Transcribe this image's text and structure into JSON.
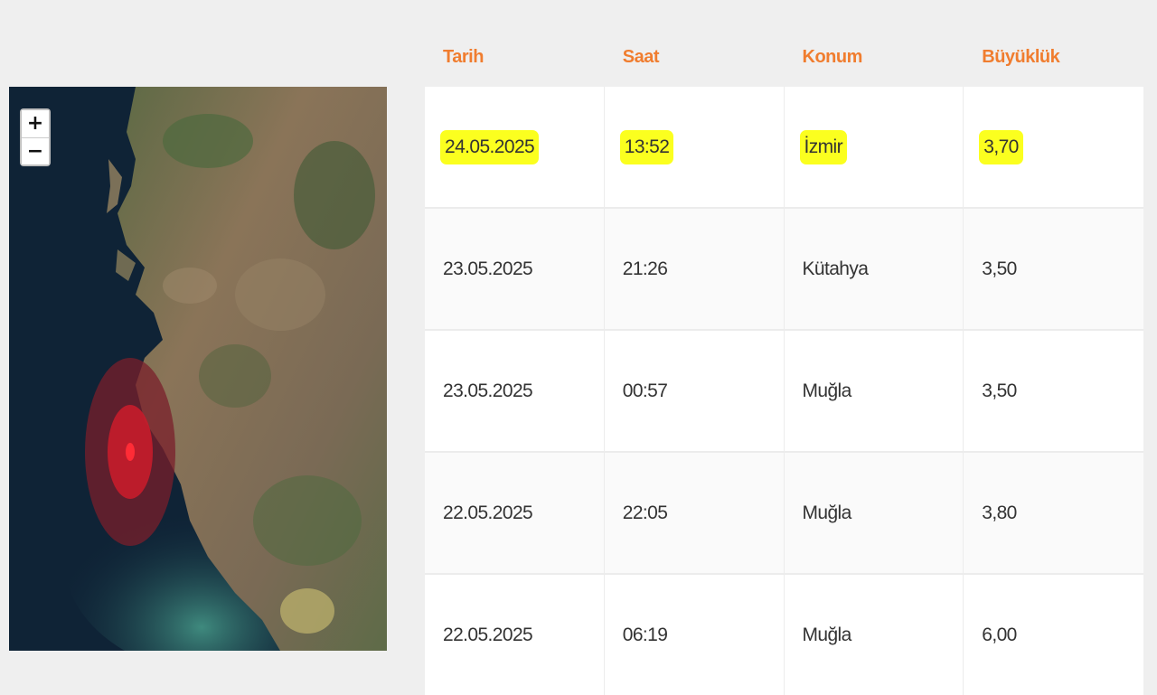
{
  "colors": {
    "header_accent": "#f07d2f",
    "highlight": "#fbff1f",
    "epicenter": "#e0202b",
    "sea": "#0f2336"
  },
  "map": {
    "zoom_in_label": "+",
    "zoom_out_label": "−",
    "marker_icon": "epicenter-marker-icon"
  },
  "table": {
    "headers": [
      "Tarih",
      "Saat",
      "Konum",
      "Büyüklük"
    ],
    "rows": [
      {
        "date": "24.05.2025",
        "time": "13:52",
        "location": "İzmir",
        "magnitude": "3,70",
        "highlighted": true
      },
      {
        "date": "23.05.2025",
        "time": "21:26",
        "location": "Kütahya",
        "magnitude": "3,50",
        "highlighted": false
      },
      {
        "date": "23.05.2025",
        "time": "00:57",
        "location": "Muğla",
        "magnitude": "3,50",
        "highlighted": false
      },
      {
        "date": "22.05.2025",
        "time": "22:05",
        "location": "Muğla",
        "magnitude": "3,80",
        "highlighted": false
      },
      {
        "date": "22.05.2025",
        "time": "06:19",
        "location": "Muğla",
        "magnitude": "6,00",
        "highlighted": false
      }
    ]
  }
}
